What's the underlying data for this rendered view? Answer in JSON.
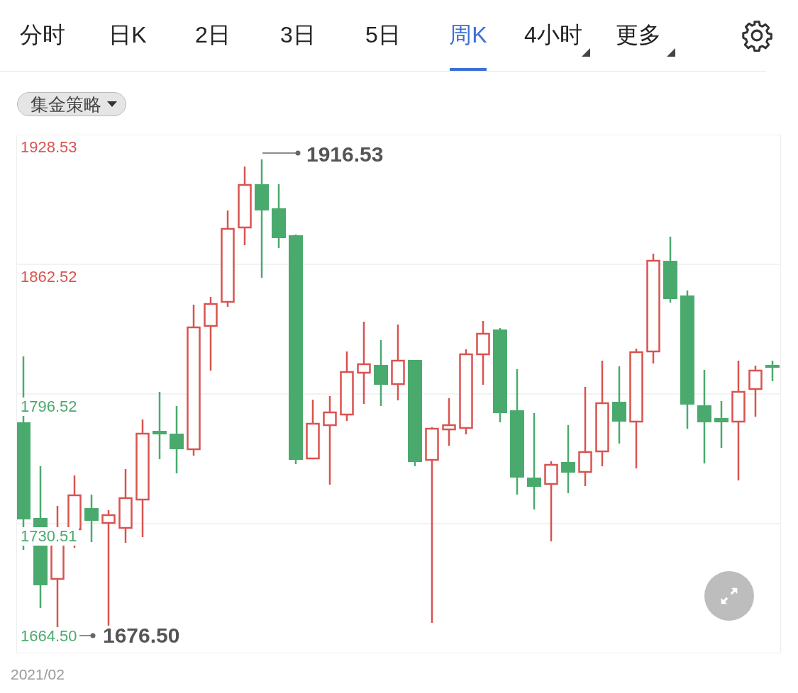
{
  "tabs": [
    {
      "label": "分时",
      "selected": false,
      "has_menu": false
    },
    {
      "label": "日K",
      "selected": false,
      "has_menu": false
    },
    {
      "label": "2日",
      "selected": false,
      "has_menu": false
    },
    {
      "label": "3日",
      "selected": false,
      "has_menu": false
    },
    {
      "label": "5日",
      "selected": false,
      "has_menu": false
    },
    {
      "label": "周K",
      "selected": true,
      "has_menu": false
    },
    {
      "label": "4小时",
      "selected": false,
      "has_menu": true
    },
    {
      "label": "更多",
      "selected": false,
      "has_menu": true
    }
  ],
  "strategy_dropdown": {
    "label": "集金策略"
  },
  "chart": {
    "y_labels": [
      {
        "text": "1928.53",
        "color": "#d9534f"
      },
      {
        "text": "1862.52",
        "color": "#d9534f"
      },
      {
        "text": "1796.52",
        "color": "#4aaa6e"
      },
      {
        "text": "1730.51",
        "color": "#4aaa6e"
      },
      {
        "text": "1664.50",
        "color": "#4aaa6e"
      }
    ],
    "high_marker": "1916.53",
    "low_marker": "1676.50"
  },
  "date_label": "2021/02"
}
